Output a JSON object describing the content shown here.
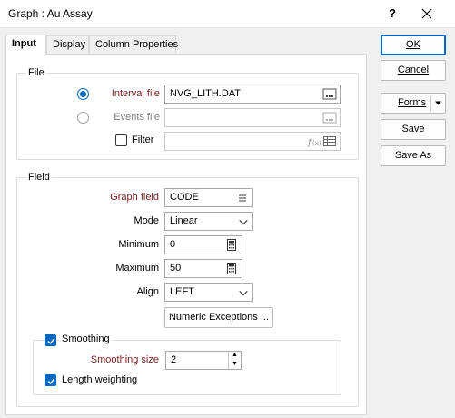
{
  "window": {
    "title": "Graph : Au Assay",
    "help": "?"
  },
  "tabs": [
    {
      "label": "Input",
      "active": true
    },
    {
      "label": "Display",
      "active": false
    },
    {
      "label": "Column Properties",
      "active": false
    }
  ],
  "file_group": {
    "title": "File",
    "interval_file": {
      "label": "Interval file",
      "value": "NVG_LITH.DAT",
      "selected": true,
      "icon": "ellipsis-icon"
    },
    "events_file": {
      "label": "Events file",
      "value": "",
      "selected": false,
      "icon": "ellipsis-icon"
    },
    "filter": {
      "label": "Filter",
      "checked": false,
      "value": "",
      "icons": [
        "function-icon",
        "table-icon"
      ]
    }
  },
  "field_group": {
    "title": "Field",
    "graph_field": {
      "label": "Graph field",
      "value": "CODE",
      "icon": "list-icon"
    },
    "mode": {
      "label": "Mode",
      "value": "Linear"
    },
    "minimum": {
      "label": "Minimum",
      "value": "0",
      "icon": "calculator-icon"
    },
    "maximum": {
      "label": "Maximum",
      "value": "50",
      "icon": "calculator-icon"
    },
    "align": {
      "label": "Align",
      "value": "LEFT"
    },
    "numeric_exceptions_label": "Numeric Exceptions ..."
  },
  "smoothing": {
    "label": "Smoothing",
    "checked": true,
    "size": {
      "label": "Smoothing size",
      "value": "2"
    },
    "length_weighting": {
      "label": "Length weighting",
      "checked": true
    }
  },
  "actions": {
    "ok": "OK",
    "cancel": "Cancel",
    "forms": "Forms",
    "save": "Save",
    "save_as": "Save As"
  },
  "colors": {
    "accent": "#0067c0",
    "required_label": "#7b1f1f"
  }
}
